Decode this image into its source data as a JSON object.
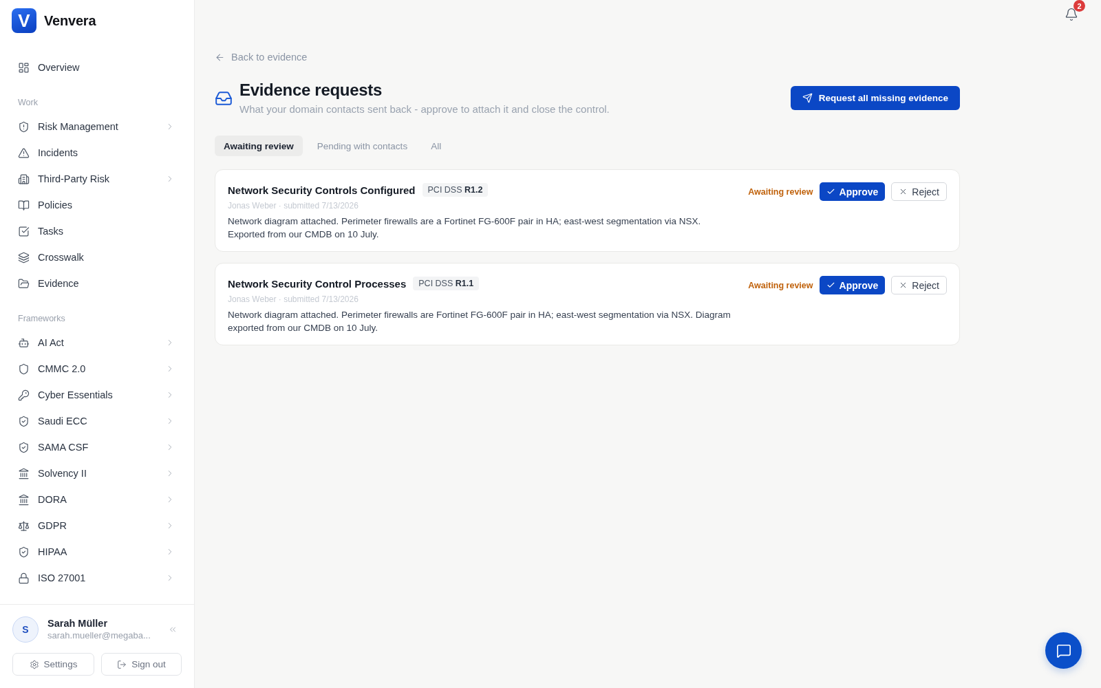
{
  "sidebar": {
    "brand": {
      "logo_letter": "V",
      "name": "Venvera"
    },
    "sections": [
      {
        "items": [
          {
            "label": "Overview",
            "selected": false,
            "has_submenu": false
          }
        ]
      },
      {
        "heading": "Work",
        "items": [
          {
            "label": "Risk Management",
            "selected": false,
            "has_submenu": true
          },
          {
            "label": "Incidents",
            "selected": false,
            "has_submenu": false
          },
          {
            "label": "Third-Party Risk",
            "selected": false,
            "has_submenu": true
          },
          {
            "label": "Policies",
            "selected": false,
            "has_submenu": false
          },
          {
            "label": "Tasks",
            "selected": false,
            "has_submenu": false
          },
          {
            "label": "Crosswalk",
            "selected": false,
            "has_submenu": false
          },
          {
            "label": "Evidence",
            "selected": false,
            "has_submenu": false
          }
        ]
      },
      {
        "heading": "Frameworks",
        "items": [
          {
            "label": "AI Act",
            "selected": false,
            "has_submenu": true
          },
          {
            "label": "CMMC 2.0",
            "selected": false,
            "has_submenu": true
          },
          {
            "label": "Cyber Essentials",
            "selected": false,
            "has_submenu": true
          },
          {
            "label": "Saudi ECC",
            "selected": false,
            "has_submenu": true
          },
          {
            "label": "SAMA CSF",
            "selected": false,
            "has_submenu": true
          },
          {
            "label": "Solvency II",
            "selected": false,
            "has_submenu": true
          },
          {
            "label": "DORA",
            "selected": false,
            "has_submenu": true
          },
          {
            "label": "GDPR",
            "selected": false,
            "has_submenu": true
          },
          {
            "label": "HIPAA",
            "selected": false,
            "has_submenu": true
          },
          {
            "label": "ISO 27001",
            "selected": false,
            "has_submenu": true
          }
        ]
      }
    ],
    "user": {
      "initial": "S",
      "name": "Sarah Müller",
      "email": "sarah.mueller@megaba..."
    },
    "footer_buttons": [
      {
        "label": "Settings"
      },
      {
        "label": "Sign out"
      }
    ]
  },
  "notifications": {
    "count": "2"
  },
  "back_link": "Back to evidence",
  "header": {
    "title": "Evidence requests",
    "subtitle": "What your domain contacts sent back - approve to attach it and close the control.",
    "action": "Request all missing evidence"
  },
  "tabs": [
    {
      "label": "Awaiting review",
      "selected": true
    },
    {
      "label": "Pending with contacts",
      "selected": false
    },
    {
      "label": "All",
      "selected": false
    }
  ],
  "requests": [
    {
      "title": "Network Security Controls Configured",
      "tag": "PCI DSS **R1.2**",
      "meta": "Jonas Weber · submitted 7/13/2026",
      "description": "Network diagram attached. Perimeter firewalls are a Fortinet FG-600F pair in HA; east-west segmentation via NSX. Exported from our CMDB on 10 July.",
      "status": "Awaiting review",
      "approve_label": "Approve",
      "reject_label": "Reject"
    },
    {
      "title": "Network Security Control Processes",
      "tag": "PCI DSS **R1.1**",
      "meta": "Jonas Weber · submitted 7/13/2026",
      "description": "Network diagram attached. Perimeter firewalls are Fortinet FG-600F pair in HA; east-west segmentation via NSX. Diagram exported from our CMDB on 10 July.",
      "status": "Awaiting review",
      "approve_label": "Approve",
      "reject_label": "Reject"
    }
  ]
}
